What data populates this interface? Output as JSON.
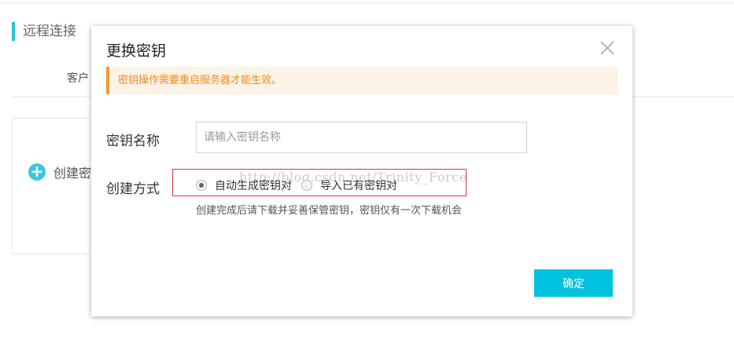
{
  "background": {
    "section_title": "远程连接",
    "sub_tab": "客户",
    "create_label": "创建密"
  },
  "modal": {
    "title": "更换密钥",
    "warning": "密钥操作需要重启服务器才能生效。",
    "name_label": "密钥名称",
    "name_placeholder": "请输入密钥名称",
    "name_value": "",
    "method_label": "创建方式",
    "options": [
      {
        "label": "自动生成密钥对",
        "checked": true
      },
      {
        "label": "导入已有密钥对",
        "checked": false
      }
    ],
    "hint": "创建完成后请下载并妥善保管密钥，密钥仅有一次下载机会",
    "confirm_label": "确定"
  },
  "watermark": "http://blog.csdn.net/Trinity_Force",
  "colors": {
    "accent": "#00c1de",
    "warning_text": "#ef8b1f",
    "warning_bg": "#fdf2e6",
    "highlight": "#d93a3a"
  }
}
